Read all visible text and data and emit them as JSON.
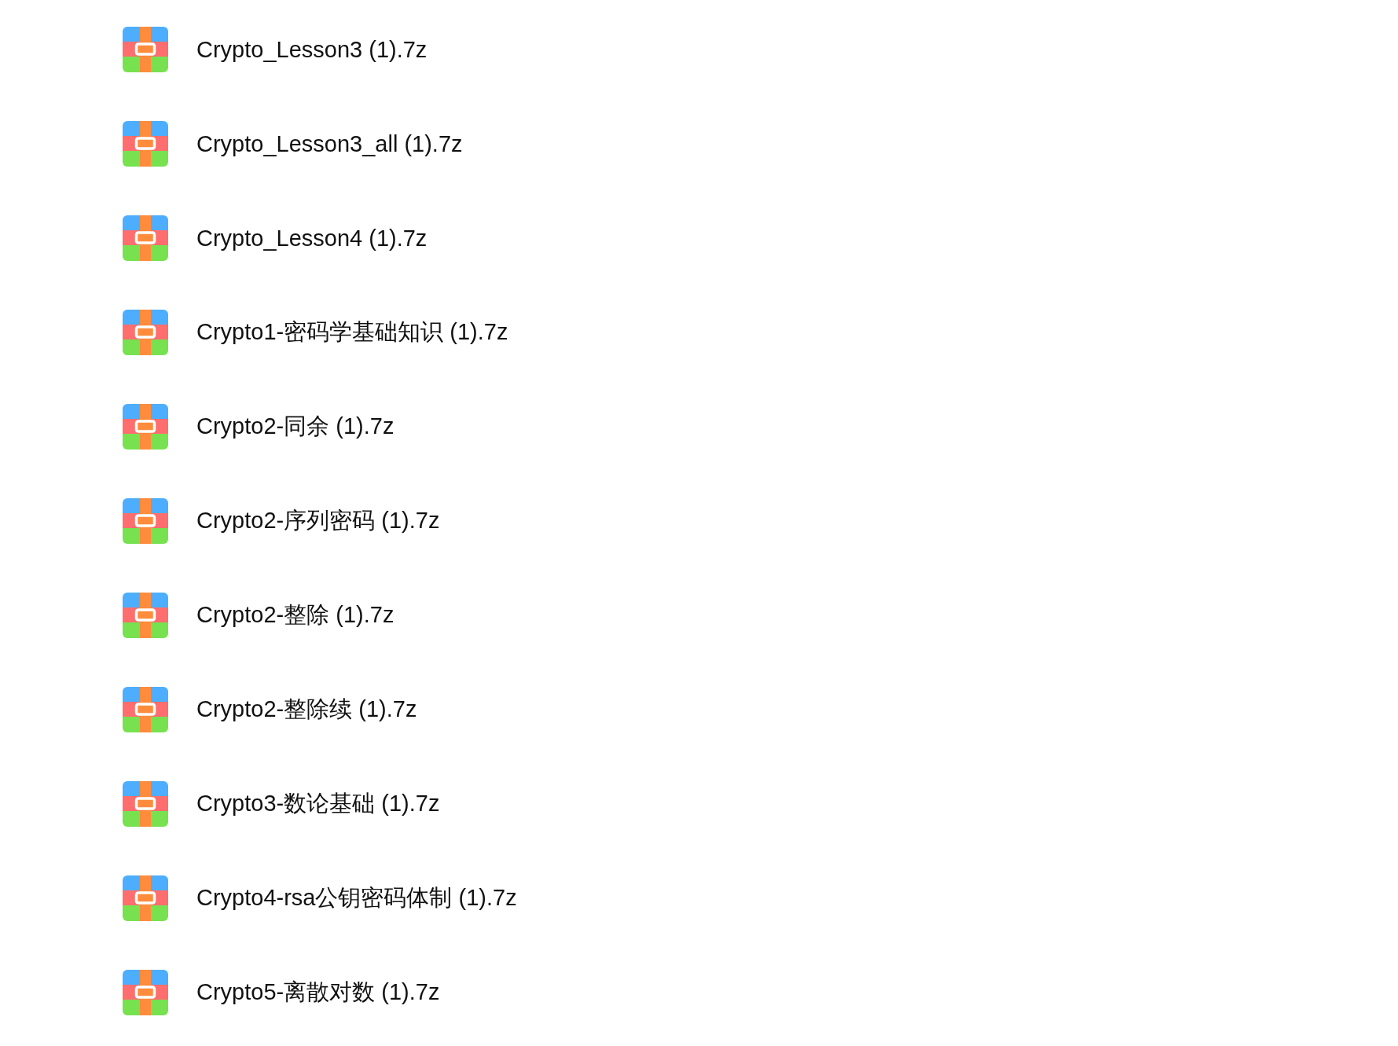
{
  "files": [
    {
      "name": "Crypto_Lesson3 (1).7z"
    },
    {
      "name": "Crypto_Lesson3_all (1).7z"
    },
    {
      "name": "Crypto_Lesson4 (1).7z"
    },
    {
      "name": "Crypto1-密码学基础知识 (1).7z"
    },
    {
      "name": "Crypto2-同余 (1).7z"
    },
    {
      "name": "Crypto2-序列密码 (1).7z"
    },
    {
      "name": "Crypto2-整除 (1).7z"
    },
    {
      "name": "Crypto2-整除续 (1).7z"
    },
    {
      "name": "Crypto3-数论基础 (1).7z"
    },
    {
      "name": "Crypto4-rsa公钥密码体制 (1).7z"
    },
    {
      "name": "Crypto5-离散对数 (1).7z"
    }
  ]
}
